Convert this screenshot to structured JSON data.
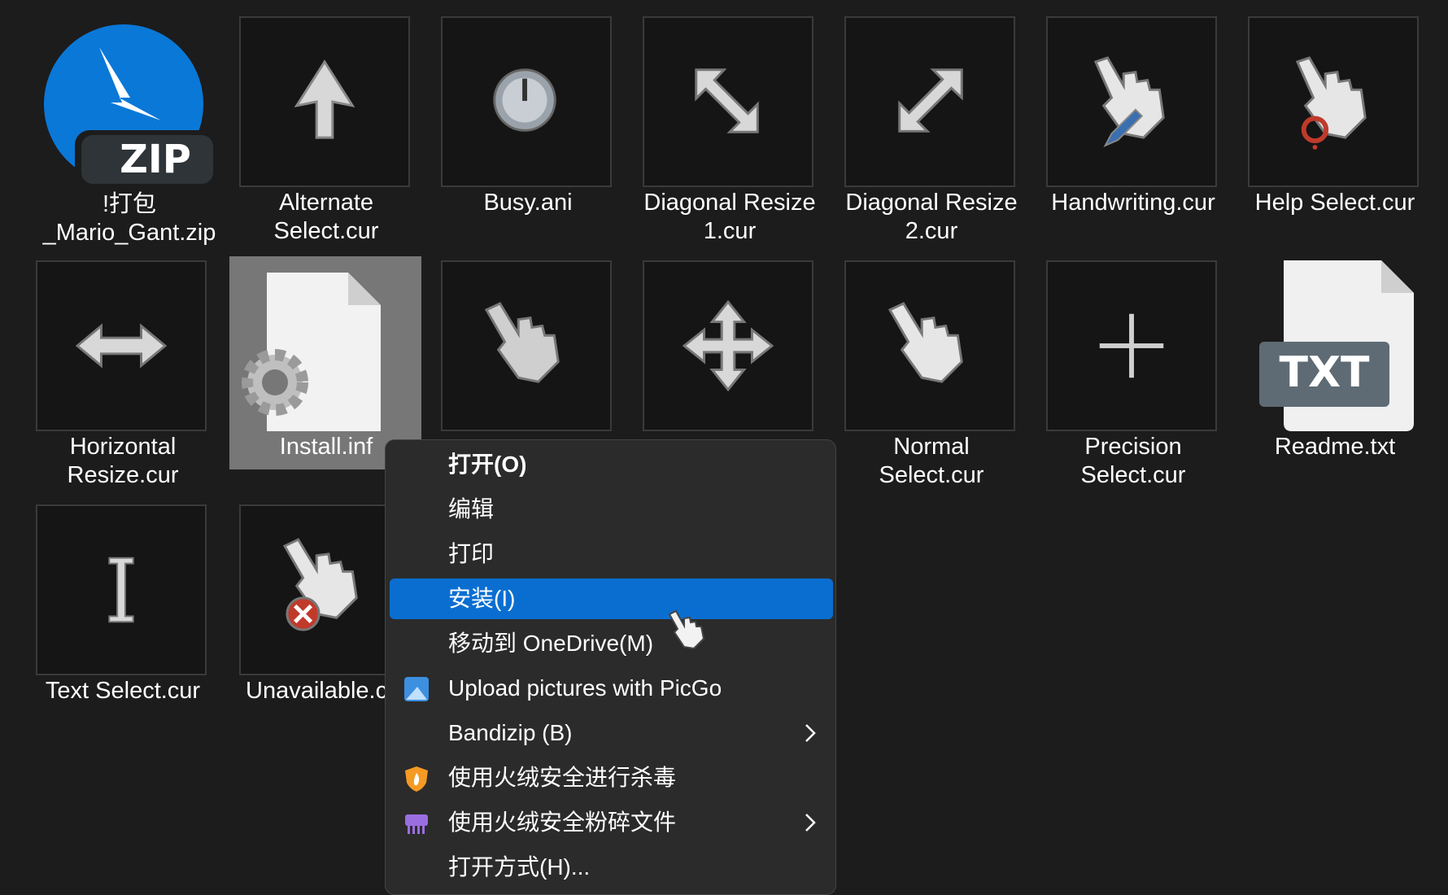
{
  "files": [
    {
      "name": "!打包\n_Mario_Gant.zip",
      "line1": "!打包",
      "line2": "_Mario_Gant.zip",
      "icon": "zip-archive-icon"
    },
    {
      "line1": "Alternate",
      "line2": "Select.cur",
      "icon": "alternate-select-cursor-icon"
    },
    {
      "line1": "Busy.ani",
      "line2": "",
      "icon": "busy-cursor-icon"
    },
    {
      "line1": "Diagonal Resize",
      "line2": "1.cur",
      "icon": "diagonal-resize-1-icon"
    },
    {
      "line1": "Diagonal Resize",
      "line2": "2.cur",
      "icon": "diagonal-resize-2-icon"
    },
    {
      "line1": "Handwriting.cur",
      "line2": "",
      "icon": "handwriting-cursor-icon"
    },
    {
      "line1": "Help Select.cur",
      "line2": "",
      "icon": "help-select-cursor-icon"
    },
    {
      "line1": "Horizontal",
      "line2": "Resize.cur",
      "icon": "horizontal-resize-icon"
    },
    {
      "line1": "Install.inf",
      "line2": "",
      "icon": "inf-settings-file-icon"
    },
    {
      "line1": "",
      "line2": "",
      "icon": "link-select-cursor-icon"
    },
    {
      "line1": "",
      "line2": "",
      "icon": "move-cursor-icon"
    },
    {
      "line1": "Normal",
      "line2": "Select.cur",
      "icon": "normal-select-cursor-icon"
    },
    {
      "line1": "Precision",
      "line2": "Select.cur",
      "icon": "precision-select-cursor-icon"
    },
    {
      "line1": "Readme.txt",
      "line2": "",
      "icon": "txt-file-icon"
    },
    {
      "line1": "Text Select.cur",
      "line2": "",
      "icon": "text-select-cursor-icon"
    },
    {
      "line1": "Unavailable.c",
      "line2": "",
      "icon": "unavailable-cursor-icon"
    }
  ],
  "zip_badge": "ZIP",
  "txt_badge": "TXT",
  "context_menu": {
    "items": [
      {
        "label": "打开(O)"
      },
      {
        "label": "编辑"
      },
      {
        "label": "打印"
      },
      {
        "label": "安装(I)"
      },
      {
        "label": "移动到 OneDrive(M)"
      },
      {
        "label": "Upload pictures with PicGo",
        "icon": "picgo-icon"
      },
      {
        "label": "Bandizip (B)"
      },
      {
        "label": "使用火绒安全进行杀毒",
        "icon": "huorong-shield-icon"
      },
      {
        "label": "使用火绒安全粉碎文件",
        "icon": "shredder-icon"
      },
      {
        "label": "打开方式(H)..."
      }
    ]
  },
  "colors": {
    "background": "#1c1c1c",
    "selection": "#777777",
    "menu_bg": "#2b2b2b",
    "highlight": "#0a6ed1"
  }
}
